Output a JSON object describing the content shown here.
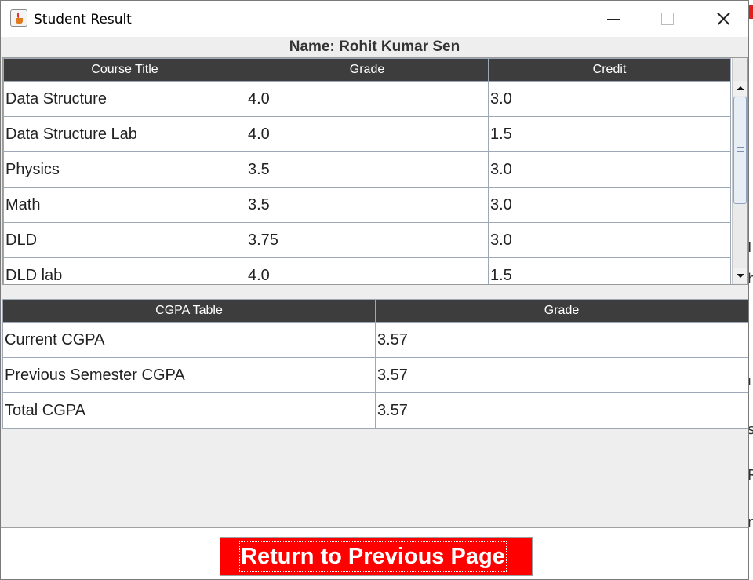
{
  "window": {
    "title": "Student Result",
    "icon": "java-cup-icon"
  },
  "student": {
    "name_label": "Name: Rohit Kumar Sen"
  },
  "course_table": {
    "headers": [
      "Course Title",
      "Grade",
      "Credit"
    ],
    "rows": [
      [
        "Data Structure",
        "4.0",
        "3.0"
      ],
      [
        "Data Structure Lab",
        "4.0",
        "1.5"
      ],
      [
        "Physics",
        "3.5",
        "3.0"
      ],
      [
        "Math",
        "3.5",
        "3.0"
      ],
      [
        "DLD",
        "3.75",
        "3.0"
      ],
      [
        "DLD lab",
        "4.0",
        "1.5"
      ]
    ]
  },
  "cgpa_table": {
    "headers": [
      "CGPA Table",
      "Grade"
    ],
    "rows": [
      [
        "Current CGPA",
        "3.57"
      ],
      [
        "Previous Semester CGPA",
        "3.57"
      ],
      [
        "Total CGPA",
        "3.57"
      ]
    ]
  },
  "footer": {
    "return_label": "Return to Previous Page"
  },
  "colors": {
    "header_bg": "#3d3d3d",
    "button_bg": "#ff0000",
    "panel_bg": "#eeeeee"
  }
}
